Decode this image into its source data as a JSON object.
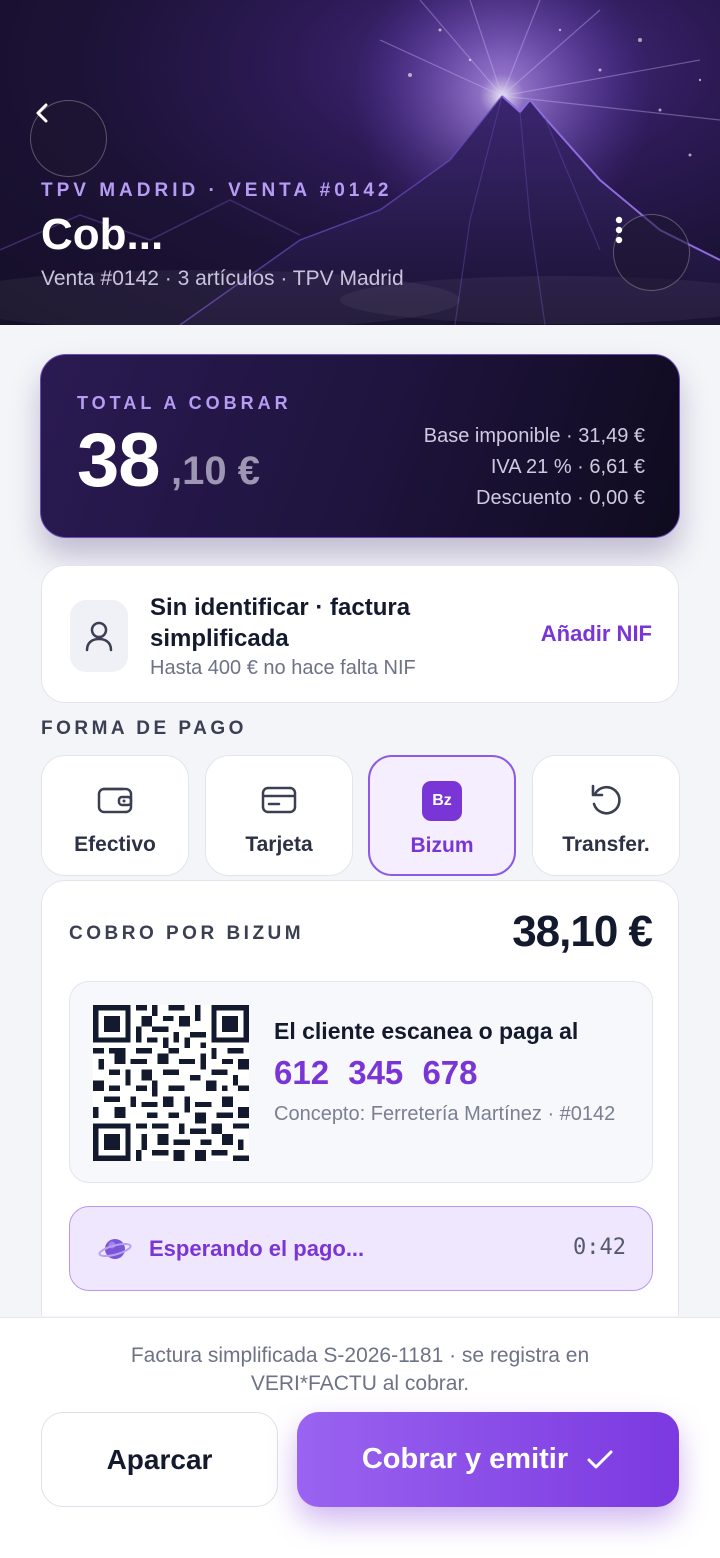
{
  "header": {
    "eyebrow": "TPV MADRID · VENTA #0142",
    "title": "Cob...",
    "subtitle": "Venta #0142 · 3 artículos · TPV Madrid",
    "back_icon": "chevron-left-icon",
    "more_icon": "more-vertical-icon"
  },
  "total": {
    "label": "TOTAL A COBRAR",
    "integer": "38",
    "decimal": ",10 €",
    "base": "Base imponible · 31,49 €",
    "iva": "IVA 21 % · 6,61 €",
    "discount": "Descuento · 0,00 €"
  },
  "customer": {
    "title": "Sin identificar · factura simplificada",
    "subtitle": "Hasta 400 € no hace falta NIF",
    "action": "Añadir NIF"
  },
  "payment": {
    "section_label": "FORMA DE PAGO",
    "methods": [
      {
        "label": "Efectivo",
        "icon": "wallet-icon"
      },
      {
        "label": "Tarjeta",
        "icon": "card-icon"
      },
      {
        "label": "Bizum",
        "icon": "bizum-icon",
        "badge": "Bz"
      },
      {
        "label": "Transfer.",
        "icon": "refresh-icon"
      }
    ],
    "selected": "Bizum"
  },
  "bizum": {
    "label": "COBRO POR BIZUM",
    "amount": "38,10 €",
    "instruction": "El cliente escanea o paga al",
    "phone": "612 345 678",
    "concept": "Concepto: Ferretería Martínez · #0142",
    "waiting": "Esperando el pago...",
    "timer": "0:42"
  },
  "footer": {
    "note": "Factura simplificada S-2026-1181 · se registra en VERI*FACTU al cobrar.",
    "park_label": "Aparcar",
    "charge_label": "Cobrar y emitir"
  },
  "colors": {
    "accent": "#7a35d6",
    "hero_bg": "#1c1236",
    "text": "#141a2e"
  }
}
